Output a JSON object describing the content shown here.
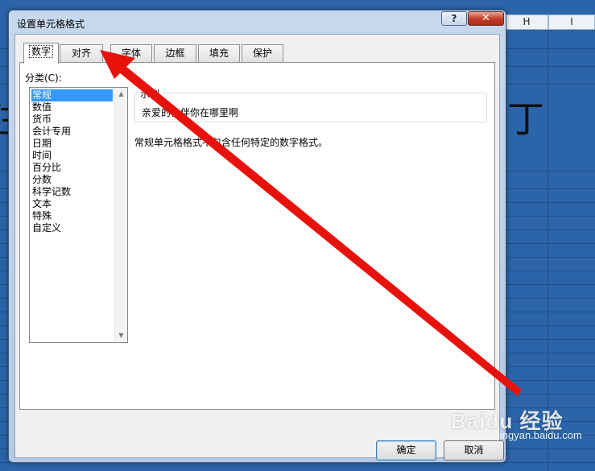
{
  "sheet": {
    "columns": [
      "H",
      "I"
    ],
    "glyph_left": "注",
    "glyph_right": "丁"
  },
  "dialog": {
    "title": "设置单元格格式",
    "help": "?",
    "close": "✕",
    "tabs": [
      {
        "label": "数字",
        "active": true
      },
      {
        "label": "对齐"
      },
      {
        "label": "字体"
      },
      {
        "label": "边框"
      },
      {
        "label": "填充"
      },
      {
        "label": "保护"
      }
    ],
    "category_label": "分类(C):",
    "categories": [
      "常规",
      "数值",
      "货币",
      "会计专用",
      "日期",
      "时间",
      "百分比",
      "分数",
      "科学记数",
      "文本",
      "特殊",
      "自定义"
    ],
    "selected_category": "常规",
    "sample_legend": "示例",
    "sample_value": "亲爱的伙伴你在哪里啊",
    "description": "常规单元格格式不包含任何特定的数字格式。",
    "ok_label": "确定",
    "cancel_label": "取消"
  },
  "annotation": {
    "arrow_color": "#e8120c"
  },
  "watermark": {
    "brand": "Baidu 经验",
    "url": "jingyan.baidu.com"
  }
}
